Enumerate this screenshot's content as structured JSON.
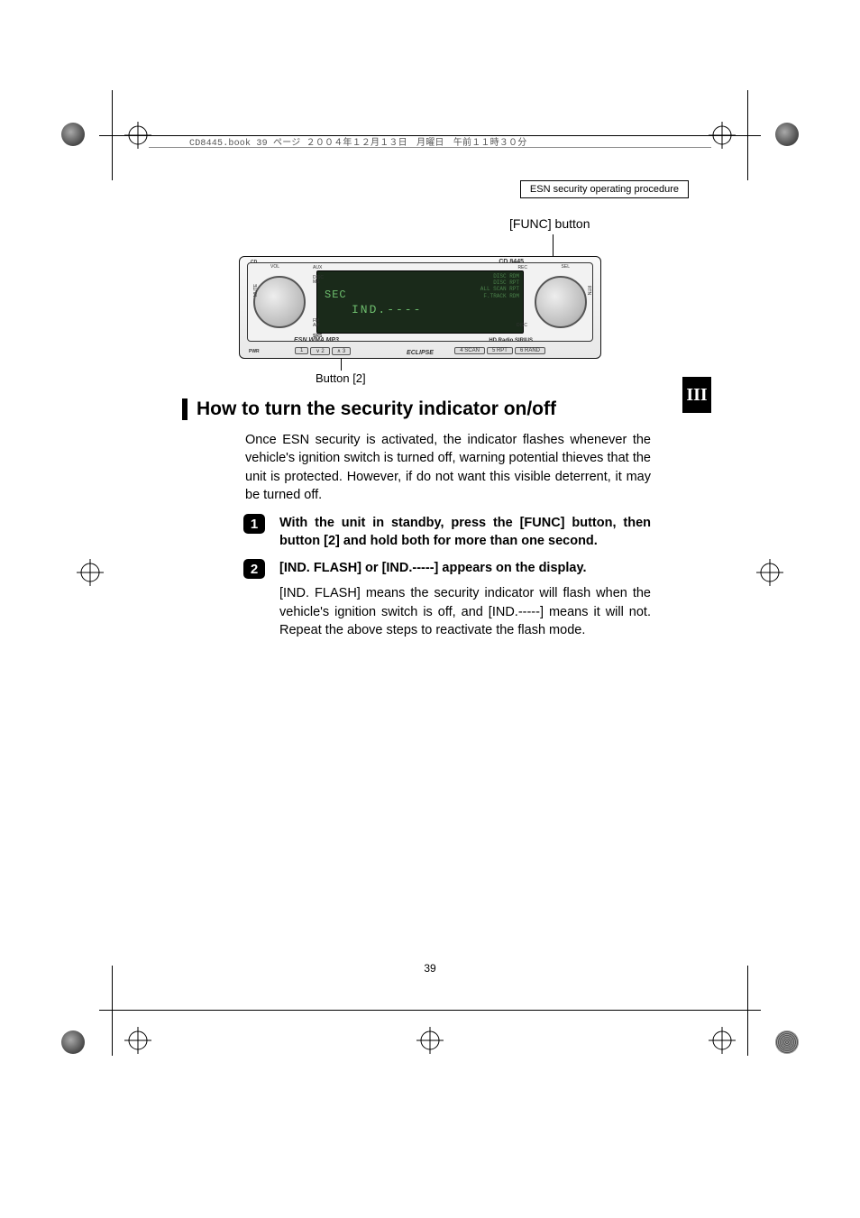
{
  "header": {
    "page_info": "CD8445.book  39 ページ  ２００４年１２月１３日　月曜日　午前１１時３０分"
  },
  "breadcrumb": "ESN security operating procedure",
  "callouts": {
    "func_button": "[FUNC] button",
    "button_2": "Button [2]"
  },
  "stereo": {
    "model": "CD 8445",
    "display_line1": "SEC",
    "display_line2": "IND.----",
    "display_indicators": "DISC RDM\nDISC RPT\nALL SCAN RPT\nF.TRACK RDM",
    "brand": "ECLIPSE",
    "esn_badge": "ESN WMA MP3",
    "hd_badge": "HD Radio SIRIUS",
    "label_vol": "VOL",
    "label_sel": "SEL",
    "label_aux": "AUX",
    "label_rec": "REC",
    "label_disc": "DISC",
    "label_fm_am": "FM\nAM",
    "label_cd": "CD",
    "label_mute": "MUTE",
    "label_pwr": "PWR",
    "label_rtn": "RTN",
    "label_srs": "SRS",
    "preset_1": "1",
    "preset_2": "2",
    "preset_3": "3",
    "preset_4": "4  SCAN",
    "preset_5": "5  RPT",
    "preset_6": "6  RAND"
  },
  "section_tab": "III",
  "heading": "How to turn the security indicator on/off",
  "intro": "Once ESN security is activated, the indicator flashes whenever the vehicle's ignition switch is turned off, warning potential thieves that the unit is protected. However, if do not want this visible deterrent, it may be turned off.",
  "steps": [
    {
      "num": "1",
      "head": "With the unit in standby, press the [FUNC] button, then button [2] and hold both for more than one second.",
      "body": ""
    },
    {
      "num": "2",
      "head": "[IND. FLASH] or [IND.-----] appears on the display.",
      "body": "[IND. FLASH] means the security indicator will flash when the vehicle's ignition switch is off, and [IND.-----] means it will not. Repeat the above steps to reactivate the flash mode."
    }
  ],
  "page_number": "39"
}
